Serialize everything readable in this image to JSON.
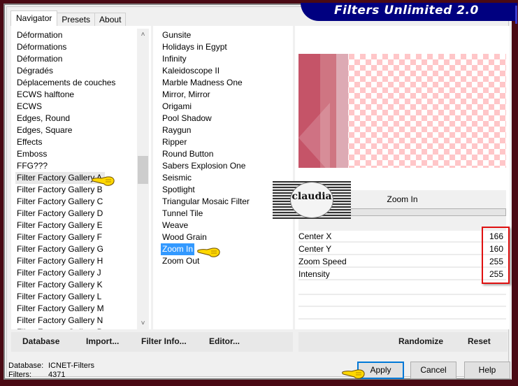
{
  "app": {
    "title": "Filters Unlimited 2.0"
  },
  "tabs": [
    {
      "label": "Navigator",
      "active": true
    },
    {
      "label": "Presets",
      "active": false
    },
    {
      "label": "About",
      "active": false
    }
  ],
  "categories": {
    "items": [
      "Déformation",
      "Déformations",
      "Déformation",
      "Dégradés",
      "Déplacements de couches",
      "ECWS halftone",
      "ECWS",
      "Edges, Round",
      "Edges, Square",
      "Effects",
      "Emboss",
      "FFG???",
      "Filter Factory Gallery A",
      "Filter Factory Gallery B",
      "Filter Factory Gallery C",
      "Filter Factory Gallery D",
      "Filter Factory Gallery E",
      "Filter Factory Gallery F",
      "Filter Factory Gallery G",
      "Filter Factory Gallery H",
      "Filter Factory Gallery J",
      "Filter Factory Gallery K",
      "Filter Factory Gallery L",
      "Filter Factory Gallery M",
      "Filter Factory Gallery N",
      "Filter Factory Gallery P"
    ],
    "selected": "Filter Factory Gallery A",
    "scroll_up_icon": "˄",
    "scroll_down_icon": "˅"
  },
  "filters": {
    "items": [
      "Gunsite",
      "Holidays in Egypt",
      "Infinity",
      "Kaleidoscope II",
      "Marble Madness One",
      "Mirror, Mirror",
      "Origami",
      "Pool Shadow",
      "Raygun",
      "Ripper",
      "Round Button",
      "Sabers Explosion One",
      "Seismic",
      "Spotlight",
      "Triangular Mosaic Filter",
      "Tunnel Tile",
      "Weave",
      "Wood Grain",
      "Zoom In",
      "Zoom Out"
    ],
    "selected": "Zoom In"
  },
  "panel": {
    "filter_name": "Zoom In",
    "params": [
      {
        "label": "Center X",
        "value": "166"
      },
      {
        "label": "Center Y",
        "value": "160"
      },
      {
        "label": "Zoom Speed",
        "value": "255"
      },
      {
        "label": "Intensity",
        "value": "255"
      }
    ],
    "watermark_text": "claudia",
    "colors": {
      "selection": "#3399ff",
      "highlight_box": "#e01010",
      "banner": "#000080"
    }
  },
  "left_buttons": {
    "database": "Database",
    "import": "Import...",
    "filter_info": "Filter Info...",
    "editor": "Editor..."
  },
  "right_buttons": {
    "randomize": "Randomize",
    "reset": "Reset"
  },
  "status": {
    "database_label": "Database:",
    "database_value": "ICNET-Filters",
    "filters_label": "Filters:",
    "filters_value": "4371"
  },
  "dialog_buttons": {
    "apply": "Apply",
    "cancel": "Cancel",
    "help": "Help"
  }
}
